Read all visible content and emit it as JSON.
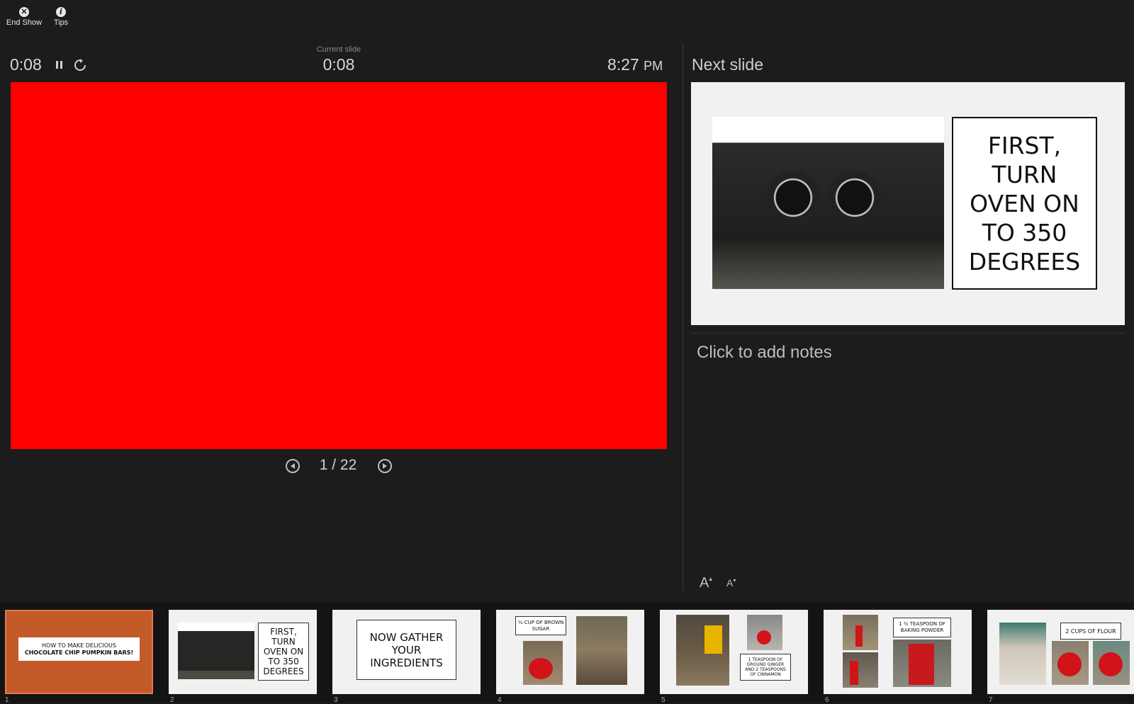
{
  "toolbar": {
    "end_show_label": "End Show",
    "tips_label": "Tips"
  },
  "timers": {
    "elapsed": "0:08",
    "current_slide_caption": "Current slide",
    "current_slide_time": "0:08",
    "clock_time": "8:27",
    "clock_ampm": "PM"
  },
  "current_slide": {
    "background_color": "#ff0000"
  },
  "navigation": {
    "position": "1 / 22"
  },
  "next_slide": {
    "heading": "Next slide",
    "card_text": "FIRST, TURN OVEN ON TO 350 DEGREES"
  },
  "notes": {
    "placeholder": "Click to add notes"
  },
  "font_controls": {
    "increase": "A",
    "decrease": "A"
  },
  "thumbnails": [
    {
      "number": "1",
      "lines": [
        "HOW TO MAKE DELICIOUS",
        "CHOCOLATE CHIP PUMPKIN BARS!"
      ],
      "selected": true
    },
    {
      "number": "2",
      "text": "FIRST, TURN OVEN ON TO 350 DEGREES"
    },
    {
      "number": "3",
      "text": "NOW GATHER YOUR INGREDIENTS"
    },
    {
      "number": "4",
      "text": "½ CUP OF BROWN SUGAR"
    },
    {
      "number": "5",
      "text": "1 TEASPOON OF GROUND GINGER AND 2 TEASPOONS OF CINNAMON"
    },
    {
      "number": "6",
      "text": "1 ½ TEASPOON OF BAKING POWDER"
    },
    {
      "number": "7",
      "text": "2 CUPS OF FLOUR"
    }
  ],
  "colors": {
    "background": "#1c1c1c",
    "selected_thumb_border": "#c95c2c",
    "thumb1_bg": "#c4592a"
  }
}
